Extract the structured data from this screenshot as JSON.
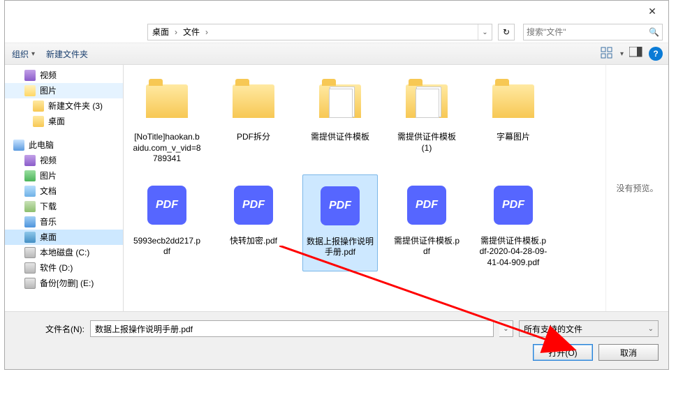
{
  "titlebar": {
    "close": "✕"
  },
  "breadcrumb": {
    "seg1": "桌面",
    "seg2": "文件",
    "sep": "›",
    "dropdown_glyph": "⌄"
  },
  "search": {
    "placeholder": "搜索\"文件\"",
    "icon": "🔍"
  },
  "refresh": {
    "icon": "↻"
  },
  "toolbar": {
    "organize": "组织",
    "drop_glyph": "▾",
    "new_folder": "新建文件夹",
    "help_glyph": "?"
  },
  "tree": [
    {
      "label": "视频",
      "icon": "ico-vid",
      "level": 1
    },
    {
      "label": "图片",
      "icon": "ico-folder sel",
      "level": 1,
      "hl": true
    },
    {
      "label": "新建文件夹 (3)",
      "icon": "ico-folder",
      "level": 2
    },
    {
      "label": "桌面",
      "icon": "ico-folder",
      "level": 2
    },
    {
      "label": "",
      "icon": "",
      "level": 1,
      "spacer": true
    },
    {
      "label": "此电脑",
      "icon": "ico-pc",
      "level": 0
    },
    {
      "label": "视频",
      "icon": "ico-vid",
      "level": 1
    },
    {
      "label": "图片",
      "icon": "ico-pic",
      "level": 1
    },
    {
      "label": "文档",
      "icon": "ico-doc",
      "level": 1
    },
    {
      "label": "下载",
      "icon": "ico-dl",
      "level": 1
    },
    {
      "label": "音乐",
      "icon": "ico-mus",
      "level": 1
    },
    {
      "label": "桌面",
      "icon": "ico-desk",
      "level": 1,
      "sel": true
    },
    {
      "label": "本地磁盘 (C:)",
      "icon": "ico-drive",
      "level": 1
    },
    {
      "label": "软件 (D:)",
      "icon": "ico-drive",
      "level": 1
    },
    {
      "label": "备份[勿删] (E:)",
      "icon": "ico-drive",
      "level": 1
    }
  ],
  "files": [
    {
      "name": "[NoTitle]haokan.baidu.com_v_vid=8789341",
      "type": "folder"
    },
    {
      "name": "PDF拆分",
      "type": "folder"
    },
    {
      "name": "需提供证件模板",
      "type": "folder-doc"
    },
    {
      "name": "需提供证件模板 (1)",
      "type": "folder-doc"
    },
    {
      "name": "字幕图片",
      "type": "folder"
    },
    {
      "name": "5993ecb2dd217.pdf",
      "type": "pdf"
    },
    {
      "name": "快转加密.pdf",
      "type": "pdf"
    },
    {
      "name": "数据上报操作说明手册.pdf",
      "type": "pdf",
      "selected": true
    },
    {
      "name": "需提供证件模板.pdf",
      "type": "pdf"
    },
    {
      "name": "需提供证件模板.pdf-2020-04-28-09-41-04-909.pdf",
      "type": "pdf"
    }
  ],
  "preview": {
    "text": "没有预览。"
  },
  "bottom": {
    "label": "文件名(N):",
    "value": "数据上报操作说明手册.pdf",
    "filter": "所有支持的文件",
    "open": "打开(O)",
    "cancel": "取消"
  },
  "pdf_glyph": "PDF"
}
